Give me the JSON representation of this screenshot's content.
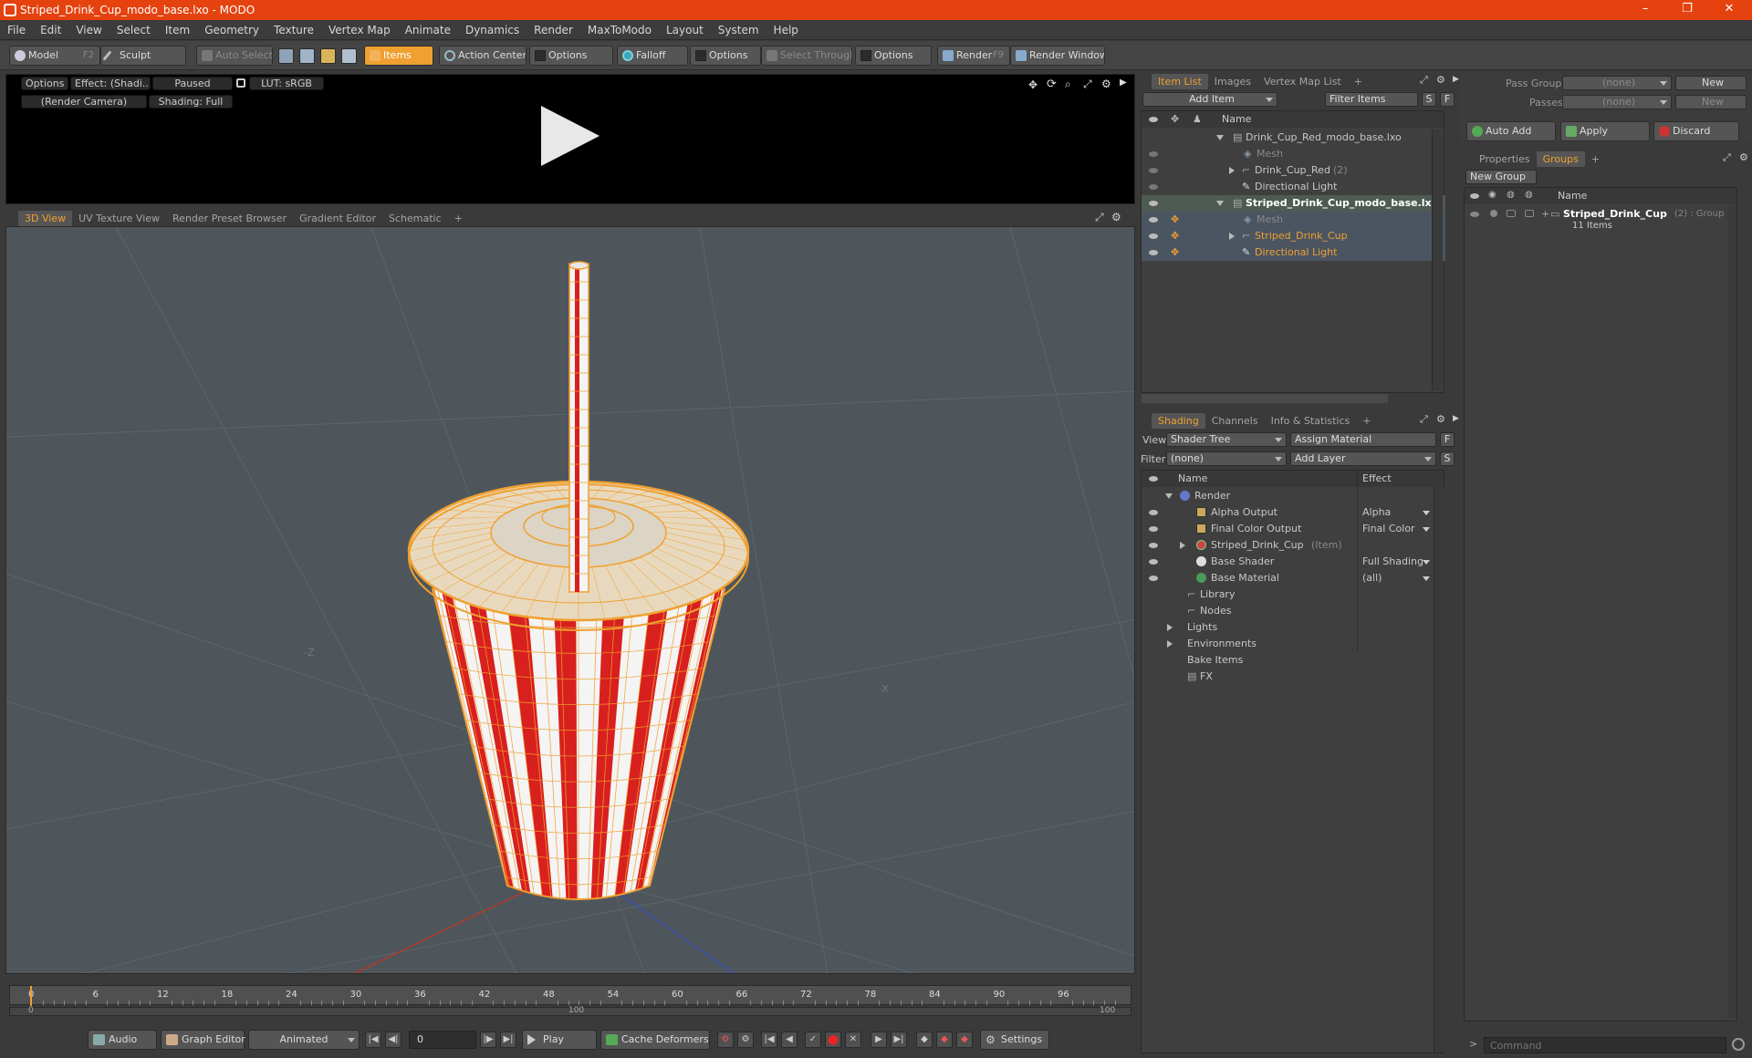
{
  "window": {
    "title": "Striped_Drink_Cup_modo_base.lxo - MODO",
    "min_icon": "minimize-icon",
    "max_icon": "restore-icon",
    "close_icon": "close-icon",
    "min": "–",
    "max": "❐",
    "close": "✕"
  },
  "menu": [
    "File",
    "Edit",
    "View",
    "Select",
    "Item",
    "Geometry",
    "Texture",
    "Vertex Map",
    "Animate",
    "Dynamics",
    "Render",
    "MaxToModo",
    "Layout",
    "System",
    "Help"
  ],
  "toolbar": {
    "model": "Model",
    "model_key": "F2",
    "sculpt": "Sculpt",
    "auto_select": "Auto Select",
    "items": "Items",
    "action_center": "Action Center",
    "options1": "Options",
    "falloff": "Falloff",
    "options2": "Options",
    "select_through": "Select Through",
    "options3": "Options",
    "render": "Render",
    "render_key": "F9",
    "render_window": "Render Window"
  },
  "preview": {
    "options": "Options",
    "effect": "Effect: (Shadi...",
    "paused": "Paused",
    "lut": "LUT: sRGB",
    "camera": "(Render Camera)",
    "shading": "Shading: Full"
  },
  "viewport_tabs": [
    "3D View",
    "UV Texture View",
    "Render Preset Browser",
    "Gradient Editor",
    "Schematic",
    "+"
  ],
  "viewport": {
    "axis_z": "-Z",
    "axis_x": "-X"
  },
  "timeline": {
    "ticks": [
      "0",
      "6",
      "12",
      "18",
      "24",
      "30",
      "36",
      "42",
      "48",
      "54",
      "60",
      "66",
      "72",
      "78",
      "84",
      "90",
      "96"
    ],
    "range_start": "0",
    "range_mid": "100",
    "range_end": "100"
  },
  "bottom": {
    "audio": "Audio",
    "graph_editor": "Graph Editor",
    "animated": "Animated",
    "frame": "0",
    "play": "Play",
    "cache_deformers": "Cache Deformers",
    "settings": "Settings"
  },
  "item_list": {
    "tabs": [
      "Item List",
      "Images",
      "Vertex Map List",
      "+"
    ],
    "add_item": "Add Item",
    "filter_items": "Filter Items",
    "s": "S",
    "f": "F",
    "col_name": "Name",
    "rows": [
      {
        "label": "Drink_Cup_Red_modo_base.lxo",
        "suffix": ""
      },
      {
        "label": "Mesh",
        "suffix": ""
      },
      {
        "label": "Drink_Cup_Red",
        "suffix": "(2)"
      },
      {
        "label": "Directional Light",
        "suffix": ""
      },
      {
        "label": "Striped_Drink_Cup_modo_base.lxo",
        "suffix": ""
      },
      {
        "label": "Mesh",
        "suffix": ""
      },
      {
        "label": "Striped_Drink_Cup",
        "suffix": ""
      },
      {
        "label": "Directional Light",
        "suffix": ""
      }
    ]
  },
  "shading": {
    "tabs": [
      "Shading",
      "Channels",
      "Info & Statistics",
      "+"
    ],
    "view_label": "View",
    "view_value": "Shader Tree",
    "assign_material": "Assign Material",
    "f": "F",
    "filter_label": "Filter",
    "filter_value": "(none)",
    "add_layer": "Add Layer",
    "s": "S",
    "col_name": "Name",
    "col_effect": "Effect",
    "rows": [
      {
        "label": "Render",
        "effect": "",
        "suffix": ""
      },
      {
        "label": "Alpha Output",
        "effect": "Alpha",
        "suffix": ""
      },
      {
        "label": "Final Color Output",
        "effect": "Final Color",
        "suffix": ""
      },
      {
        "label": "Striped_Drink_Cup",
        "effect": "",
        "suffix": "(Item)"
      },
      {
        "label": "Base Shader",
        "effect": "Full Shading",
        "suffix": ""
      },
      {
        "label": "Base Material",
        "effect": "(all)",
        "suffix": ""
      },
      {
        "label": "Library",
        "effect": "",
        "suffix": ""
      },
      {
        "label": "Nodes",
        "effect": "",
        "suffix": ""
      },
      {
        "label": "Lights",
        "effect": "",
        "suffix": ""
      },
      {
        "label": "Environments",
        "effect": "",
        "suffix": ""
      },
      {
        "label": "Bake Items",
        "effect": "",
        "suffix": ""
      },
      {
        "label": "FX",
        "effect": "",
        "suffix": ""
      }
    ]
  },
  "passes": {
    "pass_groups_label": "Pass Groups",
    "pass_groups_value": "(none)",
    "new1": "New",
    "passes_label": "Passes",
    "passes_value": "(none)",
    "new2": "New",
    "auto_add": "Auto Add",
    "apply": "Apply",
    "discard": "Discard"
  },
  "groups": {
    "tabs": [
      "Properties",
      "Groups",
      "+"
    ],
    "new_group": "New Group",
    "col_name": "Name",
    "group_name": "Striped_Drink_Cup",
    "group_suffix": "(2) : Group",
    "group_count": "11 Items"
  },
  "command": {
    "placeholder": "Command"
  },
  "colors": {
    "title_bar": "#e5420f",
    "accent": "#f0a030",
    "cup_red": "#d8201e",
    "wire": "#f0a030"
  }
}
